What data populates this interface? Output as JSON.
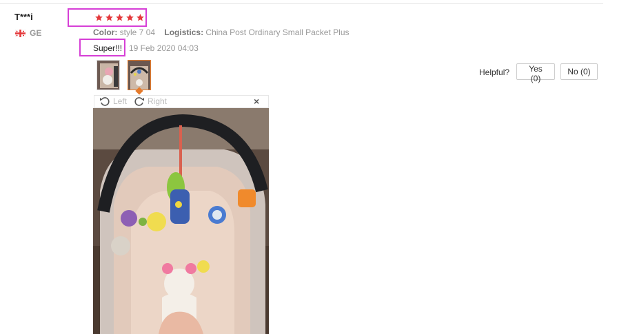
{
  "review": {
    "user": "T***i",
    "country_code": "GE",
    "rating_stars": 5,
    "color_label": "Color:",
    "color_value": "style 7 04",
    "logistics_label": "Logistics:",
    "logistics_value": "China Post Ordinary Small Packet Plus",
    "feedback": "Super!!!",
    "date": "19 Feb 2020 04:03"
  },
  "helpful": {
    "label": "Helpful?",
    "yes": "Yes (0)",
    "no": "No (0)"
  },
  "viewer": {
    "rotate_left": "Left",
    "rotate_right": "Right",
    "close_symbol": "×"
  },
  "colors": {
    "star": "#e4393c",
    "highlight": "#d63fd6",
    "active_thumb": "#e57b2c",
    "muted_text": "#999999"
  }
}
